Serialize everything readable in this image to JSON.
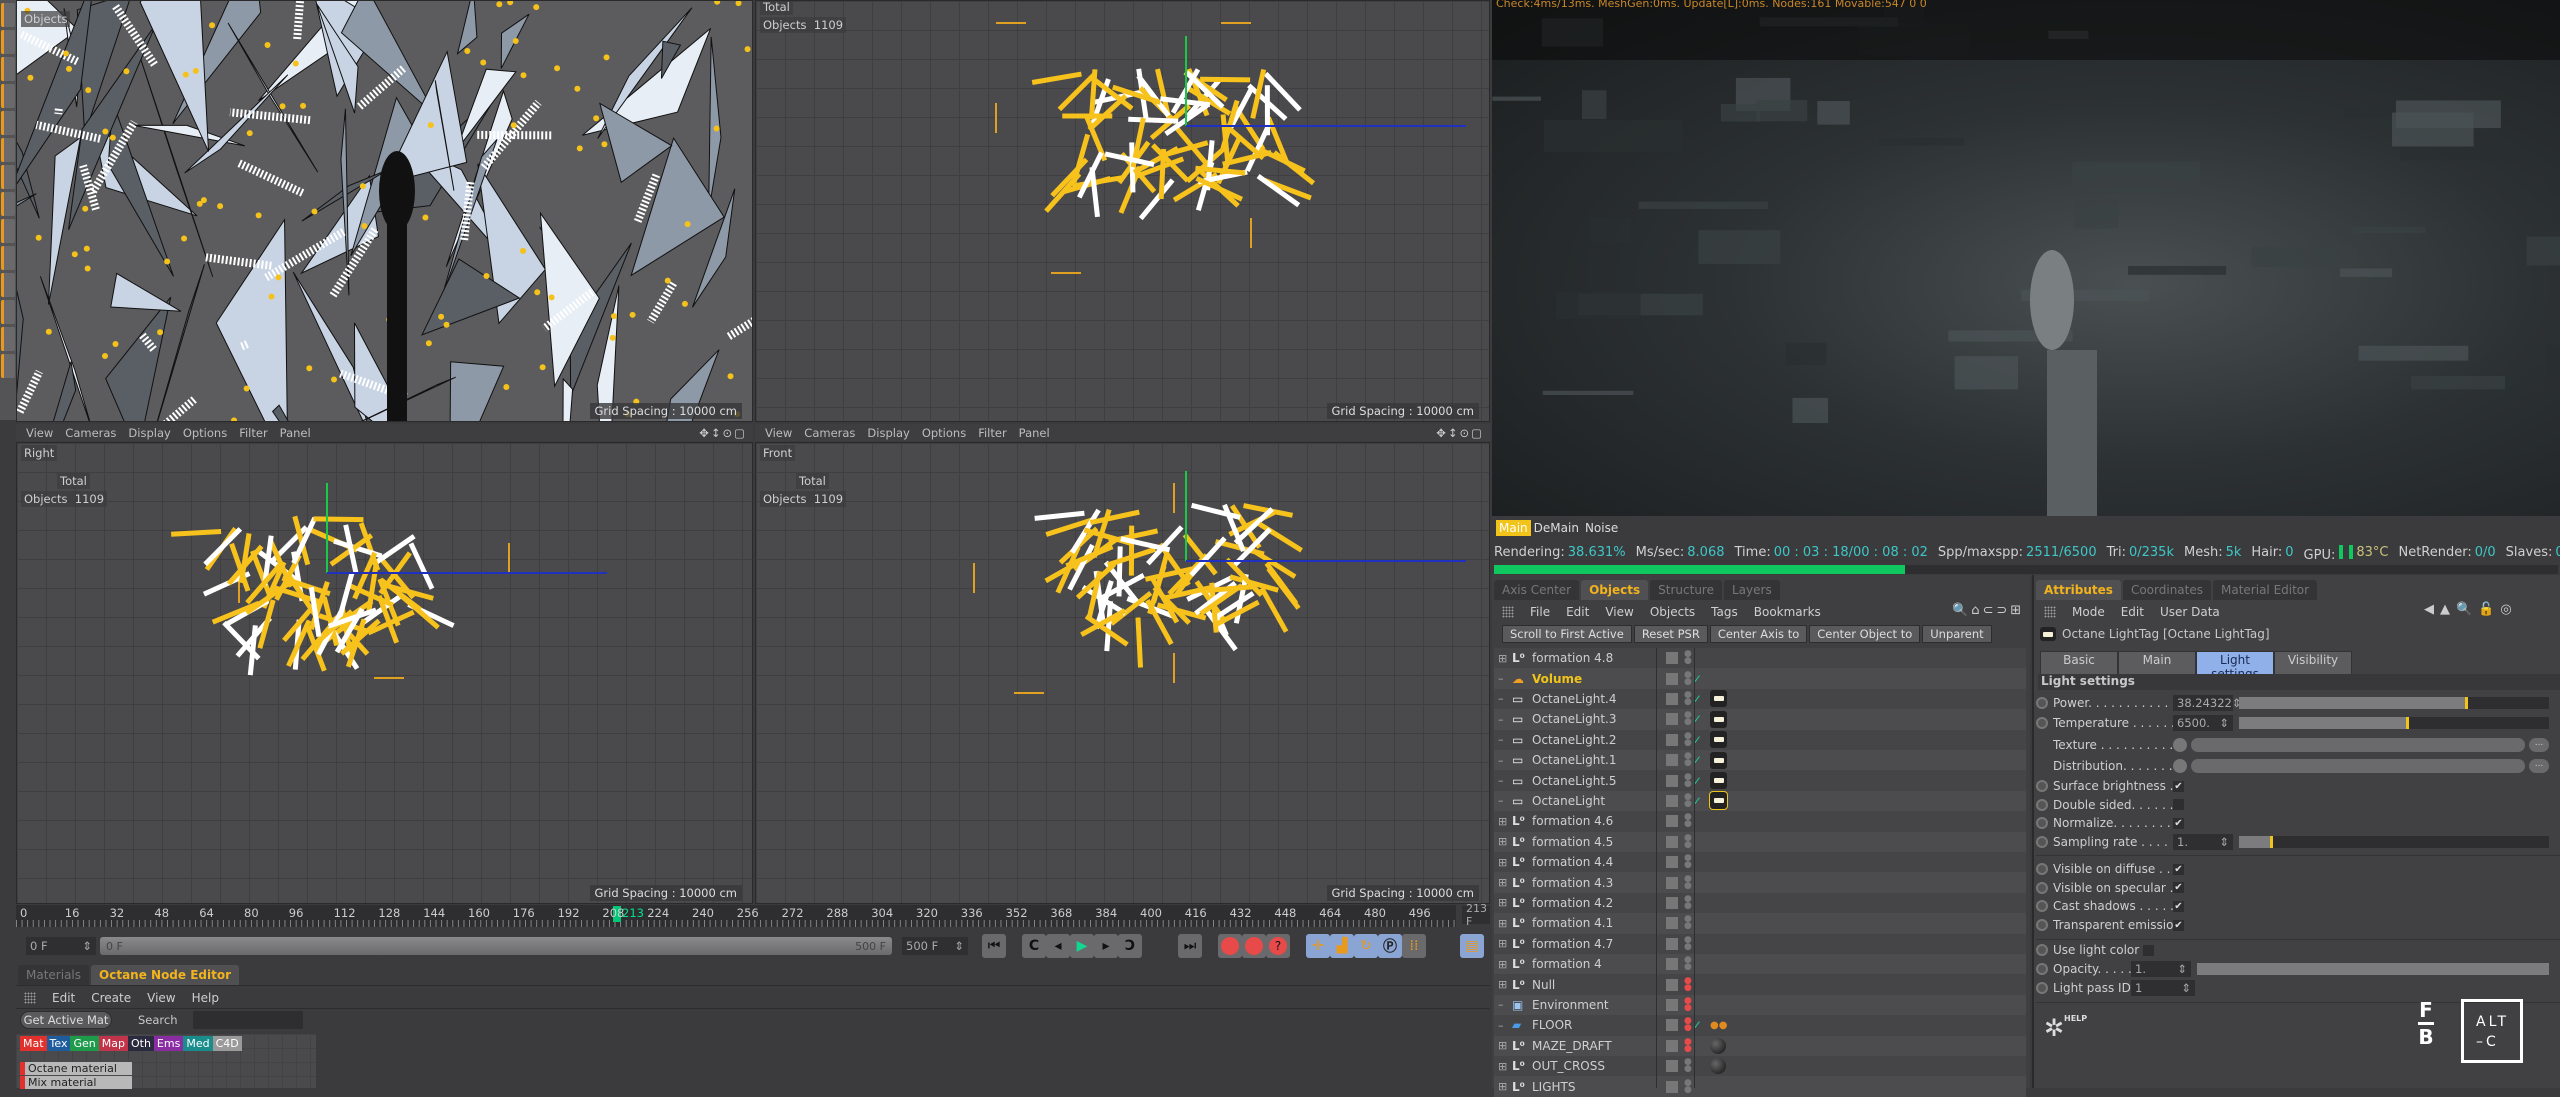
{
  "viewports": {
    "menu": [
      "View",
      "Cameras",
      "Display",
      "Options",
      "Filter",
      "Panel"
    ],
    "perspective": {
      "objects_label": "Objects"
    },
    "top": {
      "total_label": "Total",
      "objects_label": "Objects",
      "objects_count": "1109",
      "grid_spacing": "Grid Spacing : 10000 cm"
    },
    "right": {
      "name": "Right",
      "total_label": "Total",
      "objects_label": "Objects",
      "objects_count": "1109",
      "grid_spacing": "Grid Spacing : 10000 cm"
    },
    "front": {
      "name": "Front",
      "total_label": "Total",
      "objects_label": "Objects",
      "objects_count": "1109",
      "grid_spacing": "Grid Spacing : 10000 cm"
    },
    "perspective_grid_spacing": "Grid Spacing : 10000 cm"
  },
  "timeline": {
    "ticks": [
      "0",
      "16",
      "32",
      "48",
      "64",
      "80",
      "96",
      "112",
      "128",
      "144",
      "160",
      "176",
      "192",
      "208",
      "224",
      "240",
      "256",
      "272",
      "288",
      "304",
      "320",
      "336",
      "352",
      "368",
      "384",
      "400",
      "416",
      "432",
      "448",
      "464",
      "480",
      "496"
    ],
    "current_frame_marker": "213",
    "current_frame_field": "213 F",
    "start_field": "0 F",
    "range_start": "0 F",
    "range_end": "500 F",
    "end_field": "500 F",
    "playhead_color": "#00c878"
  },
  "materials": {
    "tabs": [
      "Materials",
      "Octane Node Editor"
    ],
    "active_tab": "Octane Node Editor",
    "menu": [
      "Edit",
      "Create",
      "View",
      "Help"
    ],
    "get_active_mat": "Get Active Mat",
    "search_label": "Search",
    "search_value": "",
    "categories": [
      {
        "label": "Mat",
        "color": "#e0312c"
      },
      {
        "label": "Tex",
        "color": "#1f5c9e"
      },
      {
        "label": "Gen",
        "color": "#1d9a4a"
      },
      {
        "label": "Map",
        "color": "#c2344a"
      },
      {
        "label": "Oth",
        "color": "#2b2b40"
      },
      {
        "label": "Ems",
        "color": "#8a2da3"
      },
      {
        "label": "Med",
        "color": "#1a8c8c"
      },
      {
        "label": "C4D",
        "color": "#9a9a9a"
      }
    ],
    "nodes": [
      "Octane material",
      "Mix material"
    ]
  },
  "render": {
    "debug_line": "Check:4ms/13ms. MeshGen:0ms. Update[L]:0ms. Nodes:161 Movable:547  0 0",
    "passes": [
      "Main",
      "DeMain",
      "Noise"
    ],
    "active_pass": "Main",
    "status": [
      {
        "label": "Rendering:",
        "value": "38.631%"
      },
      {
        "label": "Ms/sec:",
        "value": "8.068"
      },
      {
        "label": "Time:",
        "value": "00 : 03 : 18/00 : 08 : 02"
      },
      {
        "label": "Spp/maxspp:",
        "value": "2511/6500"
      },
      {
        "label": "Tri:",
        "value": "0/235k"
      },
      {
        "label": "Mesh:",
        "value": "5k"
      },
      {
        "label": "Hair:",
        "value": "0"
      },
      {
        "label": "GPU:",
        "value": ""
      },
      {
        "label": "",
        "value": "83°C"
      },
      {
        "label": "NetRender:",
        "value": "0/0"
      },
      {
        "label": "Slaves:",
        "value": "0"
      }
    ],
    "progress_percent": 38.631,
    "progress_color": "#10c860"
  },
  "objects": {
    "tabs": [
      "Axis Center",
      "Objects",
      "Structure",
      "Layers"
    ],
    "active_tab": "Objects",
    "menu": [
      "File",
      "Edit",
      "View",
      "Objects",
      "Tags",
      "Bookmarks"
    ],
    "buttons": [
      "Scroll to First Active",
      "Reset PSR",
      "Center Axis to",
      "Center Object to",
      "Unparent"
    ],
    "rows": [
      {
        "name": "formation 4.8",
        "icon": "null",
        "expand": true,
        "check": false,
        "tag": "",
        "dots": "grey"
      },
      {
        "name": "Volume",
        "icon": "volume",
        "expand": false,
        "check": true,
        "tag": "",
        "dots": "grey",
        "highlight": true
      },
      {
        "name": "OctaneLight.4",
        "icon": "light",
        "expand": false,
        "check": true,
        "tag": "light",
        "dots": "grey"
      },
      {
        "name": "OctaneLight.3",
        "icon": "light",
        "expand": false,
        "check": true,
        "tag": "light",
        "dots": "grey"
      },
      {
        "name": "OctaneLight.2",
        "icon": "light",
        "expand": false,
        "check": true,
        "tag": "light",
        "dots": "grey"
      },
      {
        "name": "OctaneLight.1",
        "icon": "light",
        "expand": false,
        "check": true,
        "tag": "light",
        "dots": "grey"
      },
      {
        "name": "OctaneLight.5",
        "icon": "light",
        "expand": false,
        "check": true,
        "tag": "light",
        "dots": "grey"
      },
      {
        "name": "OctaneLight",
        "icon": "light",
        "expand": false,
        "check": true,
        "tag": "light-selected",
        "dots": "grey"
      },
      {
        "name": "formation 4.6",
        "icon": "null",
        "expand": true,
        "check": false,
        "tag": "",
        "dots": "grey"
      },
      {
        "name": "formation 4.5",
        "icon": "null",
        "expand": true,
        "check": false,
        "tag": "",
        "dots": "grey"
      },
      {
        "name": "formation 4.4",
        "icon": "null",
        "expand": true,
        "check": false,
        "tag": "",
        "dots": "grey"
      },
      {
        "name": "formation 4.3",
        "icon": "null",
        "expand": true,
        "check": false,
        "tag": "",
        "dots": "grey"
      },
      {
        "name": "formation 4.2",
        "icon": "null",
        "expand": true,
        "check": false,
        "tag": "",
        "dots": "grey"
      },
      {
        "name": "formation 4.1",
        "icon": "null",
        "expand": true,
        "check": false,
        "tag": "",
        "dots": "grey"
      },
      {
        "name": "formation 4.7",
        "icon": "null",
        "expand": true,
        "check": false,
        "tag": "",
        "dots": "grey"
      },
      {
        "name": "formation 4",
        "icon": "null",
        "expand": true,
        "check": false,
        "tag": "",
        "dots": "grey"
      },
      {
        "name": "Null",
        "icon": "null",
        "expand": true,
        "check": false,
        "tag": "",
        "dots": "red"
      },
      {
        "name": "Environment",
        "icon": "environment",
        "expand": false,
        "check": false,
        "tag": "",
        "dots": "red"
      },
      {
        "name": "FLOOR",
        "icon": "floor",
        "expand": false,
        "check": true,
        "tag": "dots",
        "dots": "red"
      },
      {
        "name": "MAZE_DRAFT",
        "icon": "null",
        "expand": true,
        "check": false,
        "tag": "material",
        "dots": "red"
      },
      {
        "name": "OUT_CROSS",
        "icon": "null",
        "expand": true,
        "check": false,
        "tag": "material",
        "dots": "grey"
      },
      {
        "name": "LIGHTS",
        "icon": "null",
        "expand": true,
        "check": false,
        "tag": "",
        "dots": "grey"
      }
    ]
  },
  "attributes": {
    "tabs": [
      "Attributes",
      "Coordinates",
      "Material Editor"
    ],
    "active_tab": "Attributes",
    "menu": [
      "Mode",
      "Edit",
      "User Data"
    ],
    "object_title": "Octane LightTag [Octane LightTag]",
    "subtabs": [
      "Basic",
      "Main",
      "Light settings",
      "Visibility"
    ],
    "active_subtab": "Light settings",
    "section": "Light settings",
    "power": {
      "label": "Power. . . . . . . . . . . . .",
      "value": "38.24322",
      "slider_fraction": 0.73
    },
    "temperature": {
      "label": "Temperature . . . . . . .",
      "value": "6500.",
      "slider_fraction": 0.54
    },
    "texture": {
      "label": "Texture . . . . . . . . . . . ."
    },
    "distribution": {
      "label": "Distribution. . . . . . . ."
    },
    "checks": [
      {
        "label": "Surface brightness . .",
        "checked": true
      },
      {
        "label": "Double sided. . . . . . .",
        "checked": false
      },
      {
        "label": "Normalize. . . . . . . . .",
        "checked": true
      }
    ],
    "sampling_rate": {
      "label": "Sampling rate . . . . . .",
      "value": "1.",
      "slider_fraction": 0.1
    },
    "visibility_checks": [
      {
        "label": "Visible on diffuse . . .",
        "checked": true
      },
      {
        "label": "Visible on specular . .",
        "checked": true
      },
      {
        "label": "Cast shadows . . . . . .",
        "checked": true
      },
      {
        "label": "Transparent emission",
        "checked": true
      }
    ],
    "use_light_color": {
      "label": "Use light color",
      "checked": false
    },
    "opacity": {
      "label": "Opacity. . . . .",
      "value": "1."
    },
    "light_pass_id": {
      "label": "Light pass ID",
      "value": "1"
    },
    "help_label": "HELP",
    "logo_fb": "F B",
    "logo_altc": "ALT -C"
  }
}
